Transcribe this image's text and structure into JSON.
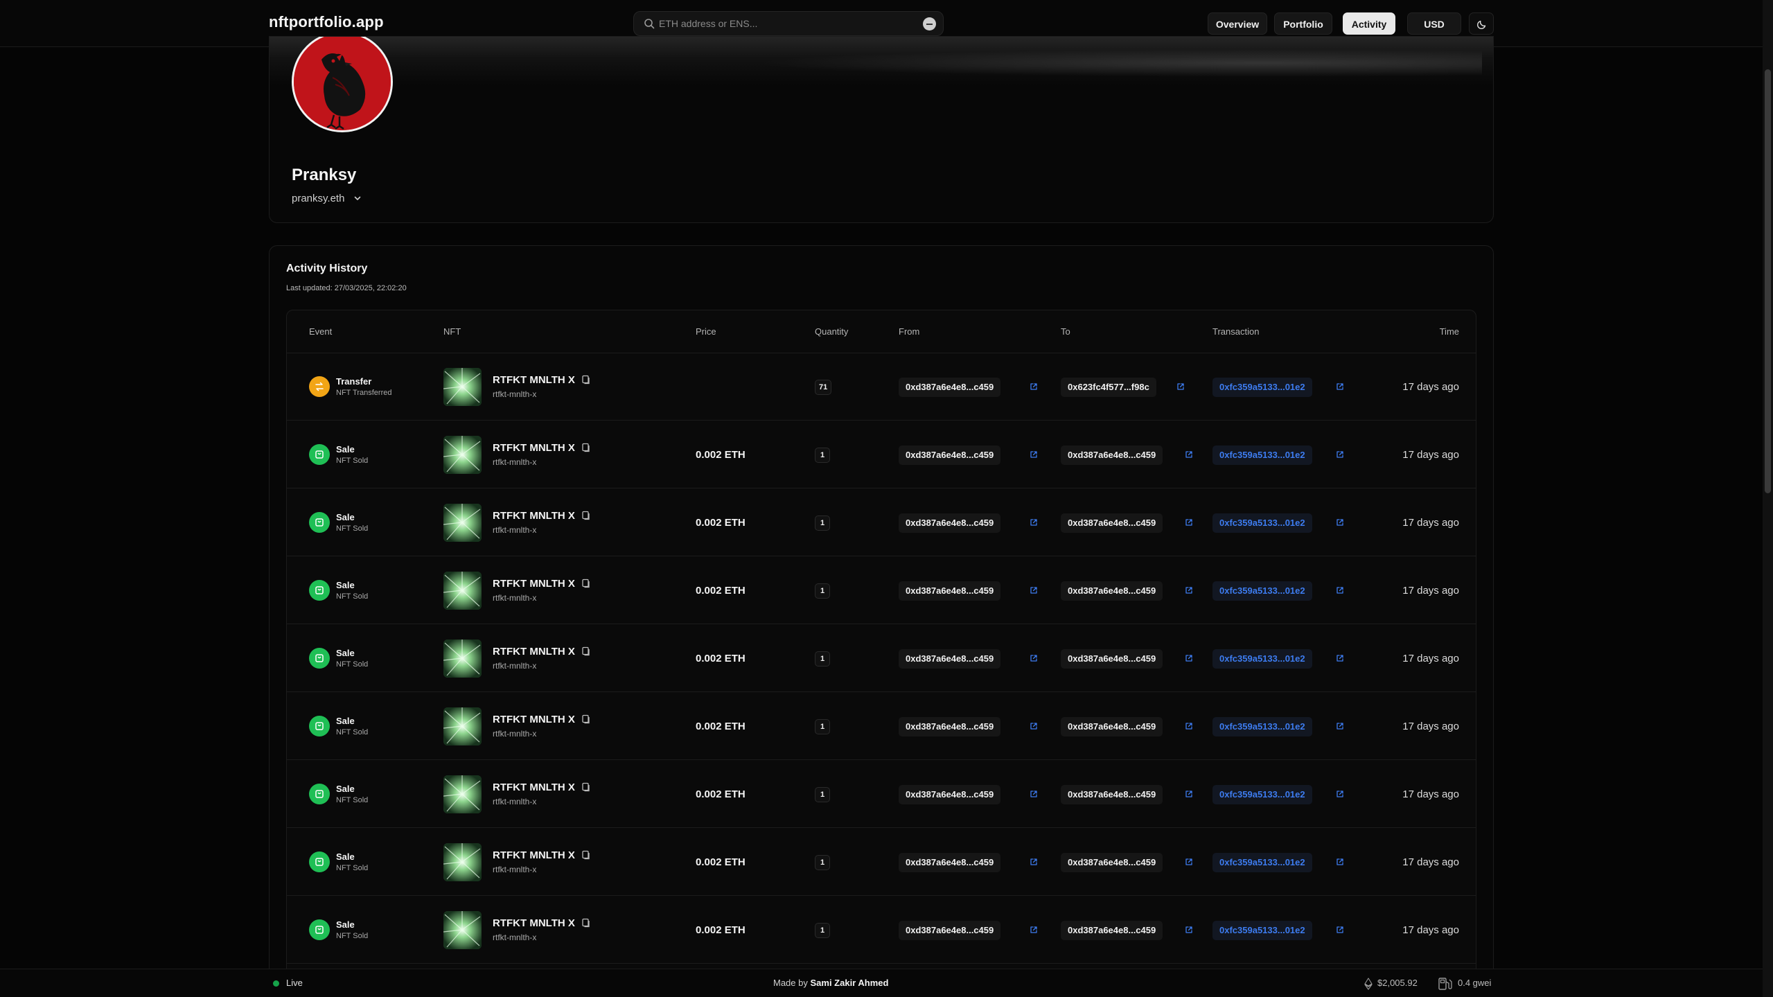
{
  "nav": {
    "brand": "nftportfolio.app",
    "search_placeholder": "ETH address or ENS...",
    "buttons": [
      {
        "label": "Overview",
        "active": false
      },
      {
        "label": "Portfolio",
        "active": false
      },
      {
        "label": "Activity",
        "active": true
      },
      {
        "label": "USD",
        "active": false
      }
    ],
    "theme_icon": "moon-icon"
  },
  "profile": {
    "name": "Pranksy",
    "ens": "pranksy.eth",
    "avatar_color": "#c0141a"
  },
  "activity": {
    "title": "Activity History",
    "last_updated": "Last updated: 27/03/2025, 22:02:20",
    "columns": [
      "Event",
      "NFT",
      "Price",
      "Quantity",
      "From",
      "To",
      "Transaction",
      "Time"
    ],
    "rows": [
      {
        "event": "Transfer",
        "event_sub": "NFT Transferred",
        "event_type": "transfer",
        "nft_name": "RTFKT MNLTH X",
        "nft_slug": "rtfkt-mnlth-x",
        "price": "",
        "quantity": "71",
        "from": "0xd387a6e4e8...c459",
        "to": "0x623fc4f577...f98c",
        "tx": "0xfc359a5133...01e2",
        "time": "17 days ago"
      },
      {
        "event": "Sale",
        "event_sub": "NFT Sold",
        "event_type": "sale",
        "nft_name": "RTFKT MNLTH X",
        "nft_slug": "rtfkt-mnlth-x",
        "price": "0.002 ETH",
        "quantity": "1",
        "from": "0xd387a6e4e8...c459",
        "to": "0xd387a6e4e8...c459",
        "tx": "0xfc359a5133...01e2",
        "time": "17 days ago"
      },
      {
        "event": "Sale",
        "event_sub": "NFT Sold",
        "event_type": "sale",
        "nft_name": "RTFKT MNLTH X",
        "nft_slug": "rtfkt-mnlth-x",
        "price": "0.002 ETH",
        "quantity": "1",
        "from": "0xd387a6e4e8...c459",
        "to": "0xd387a6e4e8...c459",
        "tx": "0xfc359a5133...01e2",
        "time": "17 days ago"
      },
      {
        "event": "Sale",
        "event_sub": "NFT Sold",
        "event_type": "sale",
        "nft_name": "RTFKT MNLTH X",
        "nft_slug": "rtfkt-mnlth-x",
        "price": "0.002 ETH",
        "quantity": "1",
        "from": "0xd387a6e4e8...c459",
        "to": "0xd387a6e4e8...c459",
        "tx": "0xfc359a5133...01e2",
        "time": "17 days ago"
      },
      {
        "event": "Sale",
        "event_sub": "NFT Sold",
        "event_type": "sale",
        "nft_name": "RTFKT MNLTH X",
        "nft_slug": "rtfkt-mnlth-x",
        "price": "0.002 ETH",
        "quantity": "1",
        "from": "0xd387a6e4e8...c459",
        "to": "0xd387a6e4e8...c459",
        "tx": "0xfc359a5133...01e2",
        "time": "17 days ago"
      },
      {
        "event": "Sale",
        "event_sub": "NFT Sold",
        "event_type": "sale",
        "nft_name": "RTFKT MNLTH X",
        "nft_slug": "rtfkt-mnlth-x",
        "price": "0.002 ETH",
        "quantity": "1",
        "from": "0xd387a6e4e8...c459",
        "to": "0xd387a6e4e8...c459",
        "tx": "0xfc359a5133...01e2",
        "time": "17 days ago"
      },
      {
        "event": "Sale",
        "event_sub": "NFT Sold",
        "event_type": "sale",
        "nft_name": "RTFKT MNLTH X",
        "nft_slug": "rtfkt-mnlth-x",
        "price": "0.002 ETH",
        "quantity": "1",
        "from": "0xd387a6e4e8...c459",
        "to": "0xd387a6e4e8...c459",
        "tx": "0xfc359a5133...01e2",
        "time": "17 days ago"
      },
      {
        "event": "Sale",
        "event_sub": "NFT Sold",
        "event_type": "sale",
        "nft_name": "RTFKT MNLTH X",
        "nft_slug": "rtfkt-mnlth-x",
        "price": "0.002 ETH",
        "quantity": "1",
        "from": "0xd387a6e4e8...c459",
        "to": "0xd387a6e4e8...c459",
        "tx": "0xfc359a5133...01e2",
        "time": "17 days ago"
      },
      {
        "event": "Sale",
        "event_sub": "NFT Sold",
        "event_type": "sale",
        "nft_name": "RTFKT MNLTH X",
        "nft_slug": "rtfkt-mnlth-x",
        "price": "0.002 ETH",
        "quantity": "1",
        "from": "0xd387a6e4e8...c459",
        "to": "0xd387a6e4e8...c459",
        "tx": "0xfc359a5133...01e2",
        "time": "17 days ago"
      }
    ]
  },
  "footer": {
    "status": "Live",
    "made_by_prefix": "Made by",
    "made_by_name": "Sami Zakir Ahmed",
    "eth_price": "$2,005.92",
    "gas": "0.4 gwei"
  },
  "colors": {
    "sale": "#1fbf55",
    "transfer": "#f2a516",
    "link": "#3d7cf0",
    "live": "#16a34a"
  }
}
